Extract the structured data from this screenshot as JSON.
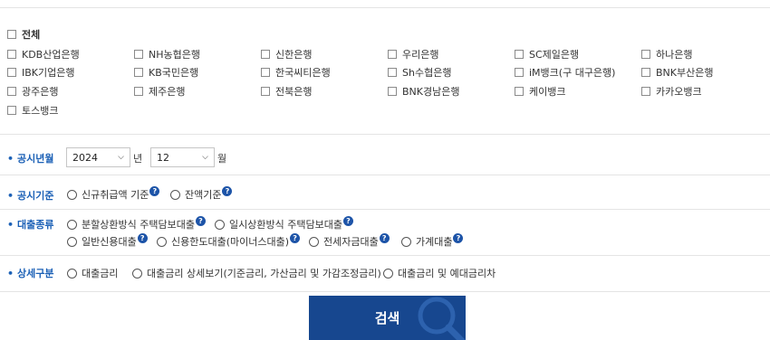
{
  "banks": {
    "all_label": "전체",
    "items": [
      "KDB산업은행",
      "NH농협은행",
      "신한은행",
      "우리은행",
      "SC제일은행",
      "하나은행",
      "IBK기업은행",
      "KB국민은행",
      "한국씨티은행",
      "Sh수협은행",
      "iM뱅크(구 대구은행)",
      "BNK부산은행",
      "광주은행",
      "제주은행",
      "전북은행",
      "BNK경남은행",
      "케이뱅크",
      "카카오뱅크",
      "토스뱅크"
    ]
  },
  "period": {
    "label": "공시년월",
    "year": "2024",
    "year_unit": "년",
    "month": "12",
    "month_unit": "월"
  },
  "basis": {
    "label": "공시기준",
    "options": [
      "신규취급액 기준",
      "잔액기준"
    ]
  },
  "loan_type": {
    "label": "대출종류",
    "options": [
      "분할상환방식 주택담보대출",
      "일시상환방식 주택담보대출",
      "일반신용대출",
      "신용한도대출(마이너스대출)",
      "전세자금대출",
      "가계대출"
    ]
  },
  "detail": {
    "label": "상세구분",
    "options": [
      "대출금리",
      "대출금리 상세보기(기준금리, 가산금리 및 가감조정금리)",
      "대출금리 및 예대금리차"
    ]
  },
  "search_button": "검색",
  "colors": {
    "accent": "#1b60b6",
    "button": "#17478f"
  }
}
